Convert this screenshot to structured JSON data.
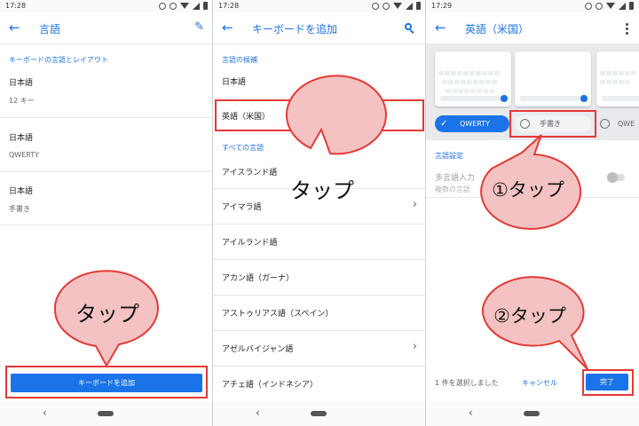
{
  "screen1": {
    "status_time": "17:28",
    "title": "言語",
    "section_header": "キーボードの言語とレイアウト",
    "items": [
      {
        "title": "日本語",
        "subtitle": "12 キー"
      },
      {
        "title": "日本語",
        "subtitle": "QWERTY"
      },
      {
        "title": "日本語",
        "subtitle": "手書き"
      }
    ],
    "add_button": "キーボードを追加",
    "callout": "タップ"
  },
  "screen2": {
    "status_time": "17:28",
    "title": "キーボードを追加",
    "candidates_header": "言語の候補",
    "candidates": [
      "日本語",
      "英語（米国）"
    ],
    "all_header": "すべての言語",
    "languages": [
      {
        "label": "アイスランド語",
        "chevron": false
      },
      {
        "label": "アイマラ語",
        "chevron": true
      },
      {
        "label": "アイルランド語",
        "chevron": false
      },
      {
        "label": "アカン語（ガーナ）",
        "chevron": false
      },
      {
        "label": "アストゥリアス語（スペイン）",
        "chevron": false
      },
      {
        "label": "アゼルバイジャン語",
        "chevron": true
      },
      {
        "label": "アチェ語（インドネシア）",
        "chevron": false
      }
    ],
    "callout": "タップ"
  },
  "screen3": {
    "status_time": "17:29",
    "title": "英語（米国）",
    "options": [
      "QWERTY",
      "手書き",
      "QWE"
    ],
    "settings_header": "言語設定",
    "multilang_title": "多言語入力",
    "multilang_sub": "複数の言語",
    "selected_count": "1 件を選択しました",
    "cancel": "キャンセル",
    "done": "完了",
    "callout1": "①タップ",
    "callout2": "②タップ"
  },
  "colors": {
    "accent": "#1a73e8",
    "highlight": "#e53935",
    "callout_fill": "#f4c2c2"
  }
}
